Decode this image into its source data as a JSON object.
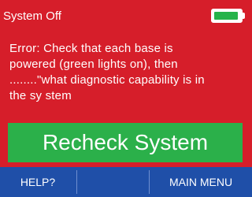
{
  "status_bar": {
    "title": "System Off",
    "battery_level": 0.95,
    "battery_icon": "battery-icon",
    "battery_color": "#26b34a"
  },
  "error": {
    "lines": [
      "Error: Check that each base is",
      "powered (green lights on), then",
      "........\"what diagnostic capability is in",
      "the sy stem"
    ]
  },
  "recheck_button": {
    "label": "Recheck System",
    "color": "#2bb04a"
  },
  "bottom_bar": {
    "help_label": "HELP?",
    "middle_label": "",
    "menu_label": "MAIN MENU",
    "color": "#1f4fa8"
  },
  "colors": {
    "background": "#d61e2a",
    "text": "#ffffff"
  }
}
